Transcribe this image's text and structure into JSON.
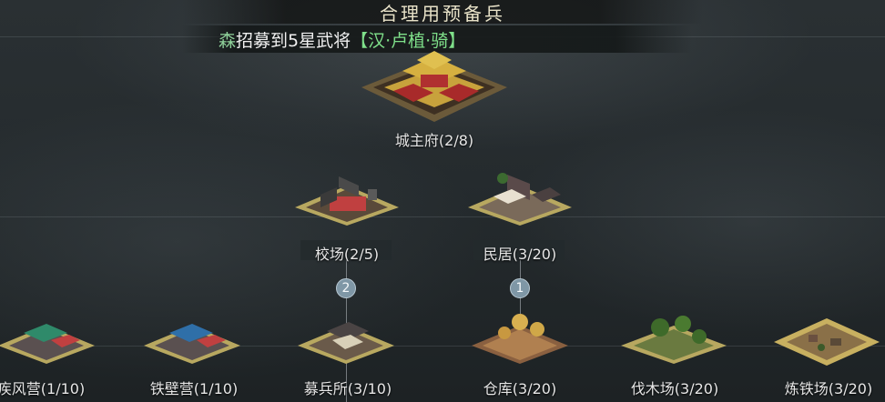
{
  "title": "合理用预备兵",
  "notice": {
    "name": "森",
    "message": "招募到5星武将",
    "hero": "【汉·卢植·骑】"
  },
  "buildings": {
    "palace": {
      "name": "城主府",
      "level": "(2/8)"
    },
    "drill": {
      "name": "校场",
      "level": "(2/5)"
    },
    "house": {
      "name": "民居",
      "level": "(3/20)"
    },
    "swift": {
      "name": "疾风营",
      "level": "(1/10)"
    },
    "iron_wall": {
      "name": "铁壁营",
      "level": "(1/10)"
    },
    "recruit": {
      "name": "募兵所",
      "level": "(3/10)"
    },
    "storage": {
      "name": "仓库",
      "level": "(3/20)"
    },
    "lumber": {
      "name": "伐木场",
      "level": "(3/20)"
    },
    "smelter": {
      "name": "炼铁场",
      "level": "(3/20)"
    }
  },
  "badges": {
    "drill_link": "2",
    "house_link": "1"
  }
}
